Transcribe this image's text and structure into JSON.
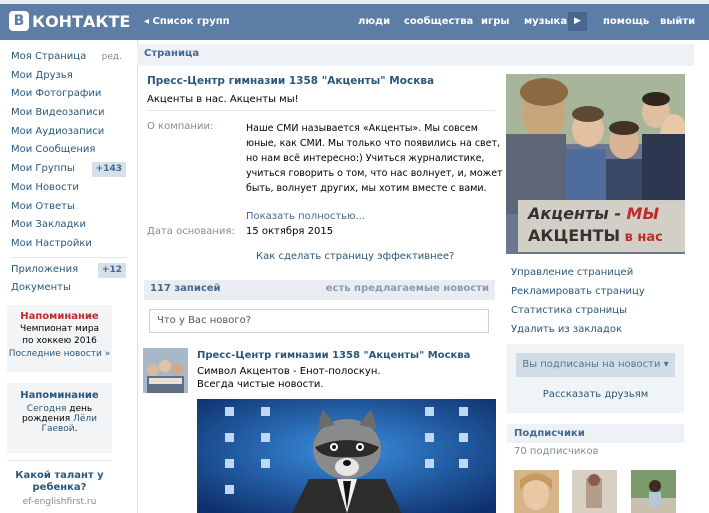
{
  "header": {
    "logo_text": "КОНТАКТЕ",
    "logo_letter": "В",
    "groups_link": "Список групп",
    "nav": [
      "люди",
      "сообщества",
      "игры",
      "музыка",
      "помощь",
      "выйти"
    ]
  },
  "sidebar": {
    "items": [
      {
        "label": "Моя Страница",
        "aux": "ред."
      },
      {
        "label": "Мои Друзья"
      },
      {
        "label": "Мои Фотографии"
      },
      {
        "label": "Мои Видеозаписи"
      },
      {
        "label": "Мои Аудиозаписи"
      },
      {
        "label": "Мои Сообщения"
      },
      {
        "label": "Мои Группы",
        "badge": "+143"
      },
      {
        "label": "Мои Новости"
      },
      {
        "label": "Мои Ответы"
      },
      {
        "label": "Мои Закладки"
      },
      {
        "label": "Мои Настройки"
      }
    ],
    "apps": {
      "label": "Приложения",
      "badge": "+12"
    },
    "docs": {
      "label": "Документы"
    },
    "reminder1": {
      "title": "Напоминание",
      "line1": "Чемпионат мира",
      "line2": "по хоккею 2016",
      "link": "Последние новости »"
    },
    "reminder2": {
      "title": "Напоминание",
      "line1": "Сегодня",
      "bday1": "день",
      "bday2": "рождения",
      "name1": "Лёли",
      "name2": "Гаевой",
      "dot": "."
    },
    "ad": {
      "title": "Какой талант у ребенка?",
      "domain": "ef-englishfirst.ru"
    }
  },
  "page": {
    "section_title": "Страница",
    "group_name": "Пресс-Центр гимназии 1358 \"Акценты\" Москва",
    "status": "Акценты в нас. Акценты мы!",
    "about_label": "О компании:",
    "about_text": "Наше СМИ называется «Акценты». Мы совсем юные, как СМИ. Мы только что появились на свет, но нам всё интересно:) Учиться журналистике, учиться говорить о том, что нас волнует, и, может быть, волнует других, мы хотим вместе с вами.",
    "show_more": "Показать полностью...",
    "founded_label": "Дата основания:",
    "founded_value": "15 октября 2015",
    "effective_link": "Как сделать страницу эффективнее?",
    "posts_count": "117 записей",
    "suggested": "есть предлагаемые новости",
    "new_post_placeholder": "Что у Вас нового?",
    "post": {
      "author": "Пресс-Центр гимназии 1358 \"Акценты\" Москва",
      "line1": "Символ Акцентов - Енот-полоскун.",
      "line2": "Всегда чистые новости."
    }
  },
  "right": {
    "cover_text1": "Акценты - ",
    "cover_text1b": "МЫ",
    "cover_text2": "АКЦЕНТЫ",
    "cover_text2b": " в нас",
    "links": [
      "Управление страницей",
      "Рекламировать страницу",
      "Статистика страницы",
      "Удалить из закладок"
    ],
    "subscribed_btn": "Вы подписаны на новости",
    "tell_friends": "Рассказать друзьям",
    "subscribers_title": "Подписчики",
    "subscribers_count": "70 подписчиков"
  }
}
